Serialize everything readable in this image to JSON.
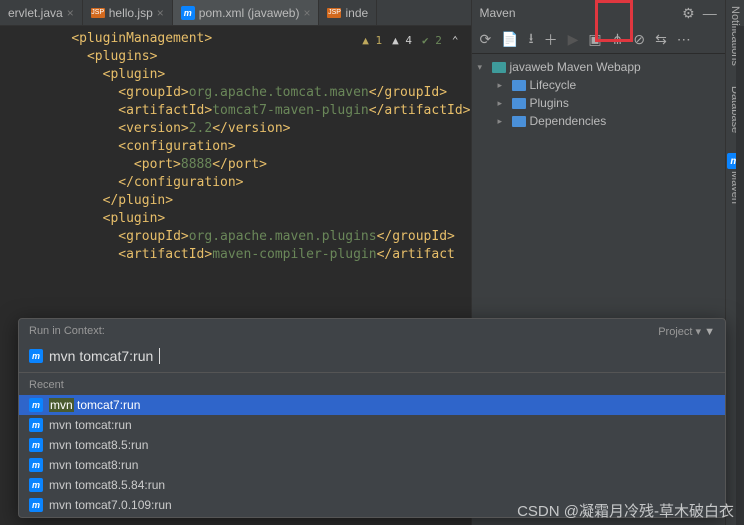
{
  "tabs": [
    {
      "label": "ervlet.java",
      "icon": "java"
    },
    {
      "label": "hello.jsp",
      "icon": "jsp"
    },
    {
      "label": "pom.xml (javaweb)",
      "icon": "m",
      "active": true
    },
    {
      "label": "inde",
      "icon": "jsp"
    }
  ],
  "indicators": {
    "warn1": "▲ 1",
    "warn4": "▲ 4",
    "check": "✔ 2",
    "up": "ˆ"
  },
  "code": [
    {
      "i": 2,
      "raw": "<pluginManagement>"
    },
    {
      "i": 3,
      "raw": "<plugins>"
    },
    {
      "i": 4,
      "raw": "<plugin>"
    },
    {
      "i": 5,
      "tag": "groupId",
      "val": "org.apache.tomcat.maven"
    },
    {
      "i": 5,
      "tag": "artifactId",
      "val": "tomcat7-maven-plugin"
    },
    {
      "i": 5,
      "tag": "version",
      "val": "2.2"
    },
    {
      "i": 5,
      "raw": "<configuration>"
    },
    {
      "i": 6,
      "tag": "port",
      "val": "8888"
    },
    {
      "i": 5,
      "raw": "</configuration>"
    },
    {
      "i": 4,
      "raw": "</plugin>"
    },
    {
      "i": 4,
      "raw": "<plugin>"
    },
    {
      "i": 5,
      "tag": "groupId",
      "val": "org.apache.maven.plugins"
    },
    {
      "i": 5,
      "tago": "artifactId",
      "val": "maven-compiler-plugin"
    }
  ],
  "mavenPanel": {
    "title": "Maven",
    "root": "javaweb Maven Webapp",
    "nodes": [
      "Lifecycle",
      "Plugins",
      "Dependencies"
    ]
  },
  "rightRail": [
    "Notifications",
    "Database",
    "Maven"
  ],
  "popup": {
    "title": "Run in Context:",
    "scope": "Project",
    "input": "mvn tomcat7:run",
    "recentLabel": "Recent",
    "items": [
      {
        "pre": "mvn ",
        "hl": "",
        "post": "tomcat7:run",
        "selhl": "mvn"
      },
      {
        "text": "mvn tomcat:run"
      },
      {
        "text": "mvn tomcat8.5:run"
      },
      {
        "text": "mvn tomcat8:run"
      },
      {
        "text": "mvn tomcat8.5.84:run"
      },
      {
        "text": "mvn tomcat7.0.109:run"
      }
    ]
  },
  "watermark": "CSDN @凝霜月冷残-草木破白衣"
}
